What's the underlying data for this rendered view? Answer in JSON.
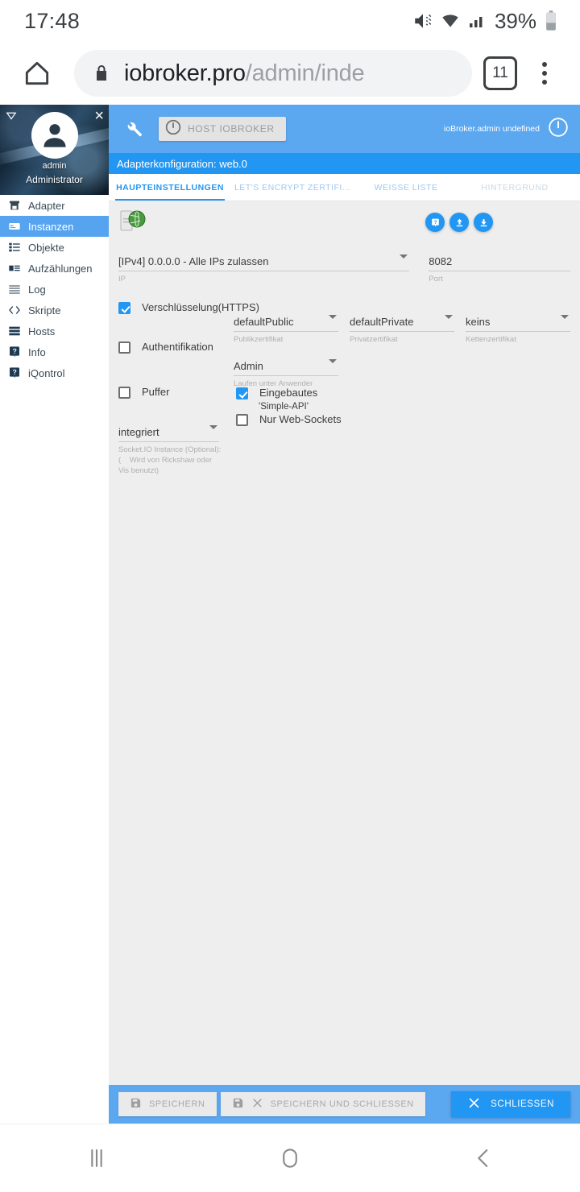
{
  "status_bar": {
    "time": "17:48",
    "battery_percent": "39%",
    "icons": [
      "mute-icon",
      "wifi-icon",
      "signal-icon",
      "battery-icon"
    ]
  },
  "browser": {
    "url_host": "iobroker.pro",
    "url_path": "/admin/inde",
    "tab_count": "11",
    "home_label": "home-icon",
    "lock_label": "lock-icon",
    "menu_label": "more-options-icon"
  },
  "sidebar": {
    "user": "admin",
    "role": "Administrator",
    "close_label": "×",
    "items": [
      {
        "label": "Adapter",
        "icon": "store-icon",
        "active": false
      },
      {
        "label": "Instanzen",
        "icon": "card-icon",
        "active": true
      },
      {
        "label": "Objekte",
        "icon": "list-icon",
        "active": false
      },
      {
        "label": "Aufzählungen",
        "icon": "list-alt-icon",
        "active": false
      },
      {
        "label": "Log",
        "icon": "menu-icon",
        "active": false
      },
      {
        "label": "Skripte",
        "icon": "code-icon",
        "active": false
      },
      {
        "label": "Hosts",
        "icon": "storage-icon",
        "active": false
      },
      {
        "label": "Info",
        "icon": "help-icon",
        "active": false
      },
      {
        "label": "iQontrol",
        "icon": "help-icon",
        "active": false
      }
    ]
  },
  "app": {
    "host_button": "HOST IOBROKER",
    "user_info": "ioBroker.admin undefined",
    "wrench_icon": "wrench-icon",
    "power_icon": "power-icon",
    "title": "Adapterkonfiguration: web.0",
    "tabs": [
      {
        "label": "HAUPTEINSTELLUNGEN"
      },
      {
        "label": "LET'S ENCRYPT ZERTIFI..."
      },
      {
        "label": "WEISSE LISTE"
      },
      {
        "label": "HINTERGRUND"
      }
    ],
    "round_buttons": [
      {
        "icon": "help-icon"
      },
      {
        "icon": "upload-icon"
      },
      {
        "icon": "download-icon"
      }
    ],
    "form": {
      "ip": {
        "value": "[IPv4] 0.0.0.0 - Alle IPs zulassen",
        "helper": "IP"
      },
      "port": {
        "value": "8082",
        "helper": "Port"
      },
      "https": {
        "label": "Verschlüsselung(HTTPS)",
        "checked": true
      },
      "public_cert": {
        "value": "defaultPublic",
        "helper": "Publikzertifikat"
      },
      "private_cert": {
        "value": "defaultPrivate",
        "helper": "Privatzertifikat"
      },
      "chain_cert": {
        "value": "keins",
        "helper": "Kettenzertifikat"
      },
      "auth": {
        "label": "Authentifikation",
        "checked": false
      },
      "run_as": {
        "value": "Admin",
        "helper": "Laufen unter Anwender"
      },
      "buffer": {
        "label": "Puffer",
        "checked": false
      },
      "builtin": {
        "label": "Eingebautes",
        "sublabel": "'Simple-API'",
        "checked": true
      },
      "websockets": {
        "label": "Nur Web-Sockets",
        "checked": false
      },
      "socketio": {
        "value": "integriert",
        "helper": "Socket.IO Instance (Optional):\n(    Wird von Rickshaw oder Vis benutzt)"
      }
    },
    "actions": {
      "save": "SPEICHERN",
      "save_close": "SPEICHERN UND SCHLIESSEN",
      "close": "SCHLIESSEN"
    },
    "colors": {
      "appbar": "#5ba7f0",
      "titlebar": "#2196f3",
      "accent": "#2196f3",
      "content_bg": "#eeeeee"
    }
  },
  "navbar": {
    "recents": "recents-icon",
    "home": "home-circle-icon",
    "back": "back-icon"
  }
}
